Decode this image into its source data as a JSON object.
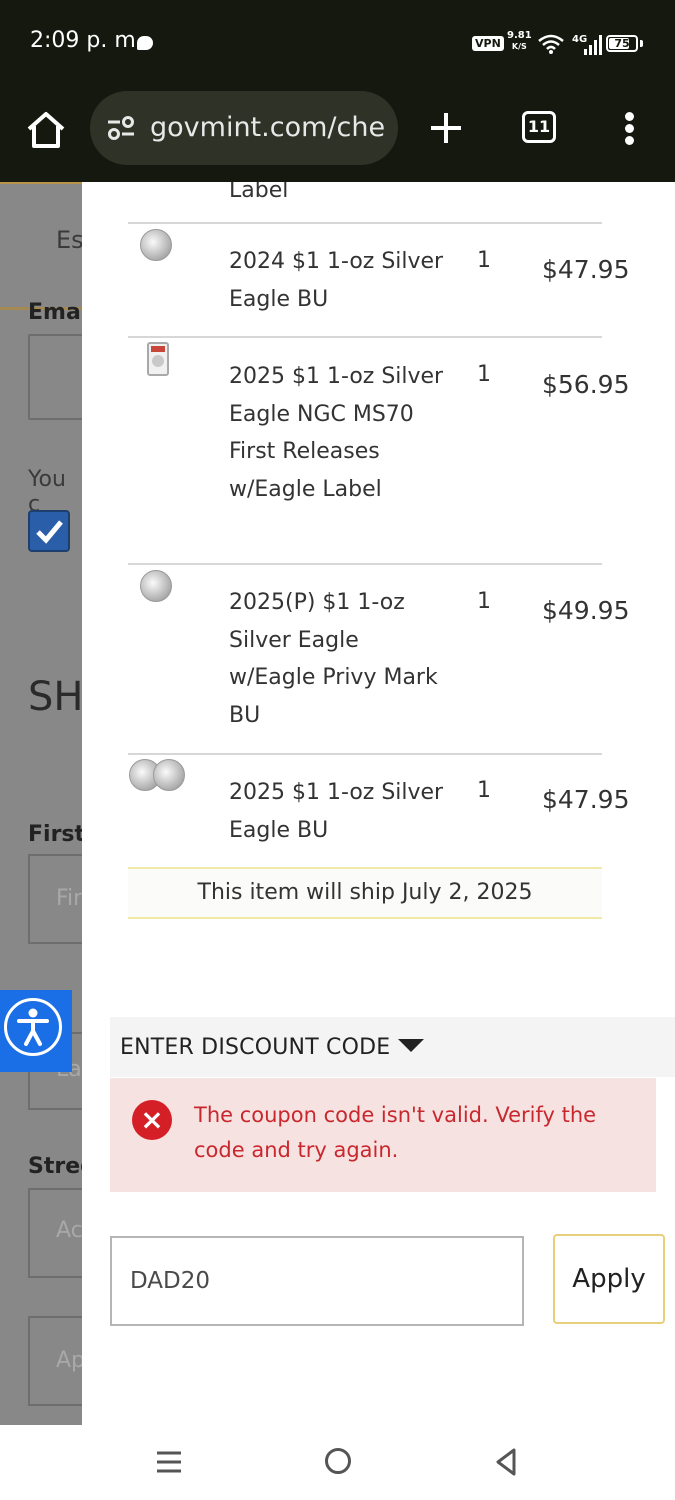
{
  "status_bar": {
    "time": "2:09 p. m.",
    "vpn_label": "VPN",
    "net_speed_value": "9.81",
    "net_speed_unit": "K/S",
    "network_label": "4G",
    "battery_level": "75",
    "battery_fraction": 0.75
  },
  "browser": {
    "url": "govmint.com/che",
    "tab_count": "11",
    "icons": [
      "home-icon",
      "site-settings-icon",
      "plus-icon",
      "tab-switcher-icon",
      "more-vert-icon"
    ]
  },
  "background_page": {
    "tab_fragment": "Es",
    "email_fragment": "Ema",
    "consent_fragment": "You c",
    "section_fragment": "SH",
    "first_label_fragment": "First",
    "first_placeholder_fragment": "Fir",
    "last_placeholder_fragment": "La",
    "street_label_fragment": "Stree",
    "street_placeholder_fragment": "Ac",
    "apt_placeholder_fragment": "Ap",
    "accent_color": "#b8944a"
  },
  "order_items": {
    "cut_off_label": "Label",
    "items": [
      {
        "name": "2024 $1 1-oz Silver Eagle BU",
        "qty": "1",
        "price": "$47.95",
        "thumb": "silver-eagle-coin"
      },
      {
        "name": "2025 $1 1-oz Silver Eagle NGC MS70 First Releases w/Eagle Label",
        "qty": "1",
        "price": "$56.95",
        "thumb": "graded-slab"
      },
      {
        "name": "2025(P) $1 1-oz Silver Eagle w/Eagle Privy Mark BU",
        "qty": "1",
        "price": "$49.95",
        "thumb": "silver-eagle-coin"
      },
      {
        "name": "2025 $1 1-oz Silver Eagle BU",
        "qty": "1",
        "price": "$47.95",
        "thumb": "two-coins"
      }
    ],
    "ship_note": "This item will ship July 2, 2025"
  },
  "discount": {
    "header": "ENTER DISCOUNT CODE",
    "error_message": "The coupon code isn't valid. Verify the code and try again.",
    "error_color": "#c8282d",
    "code_value": "DAD20",
    "apply_label": "Apply"
  },
  "accessibility_widget": {
    "icon": "accessibility-person-icon",
    "color": "#1a6fe6"
  },
  "nav_bar": {
    "icons": [
      "recents-icon",
      "home-circle-icon",
      "back-triangle-icon"
    ]
  }
}
